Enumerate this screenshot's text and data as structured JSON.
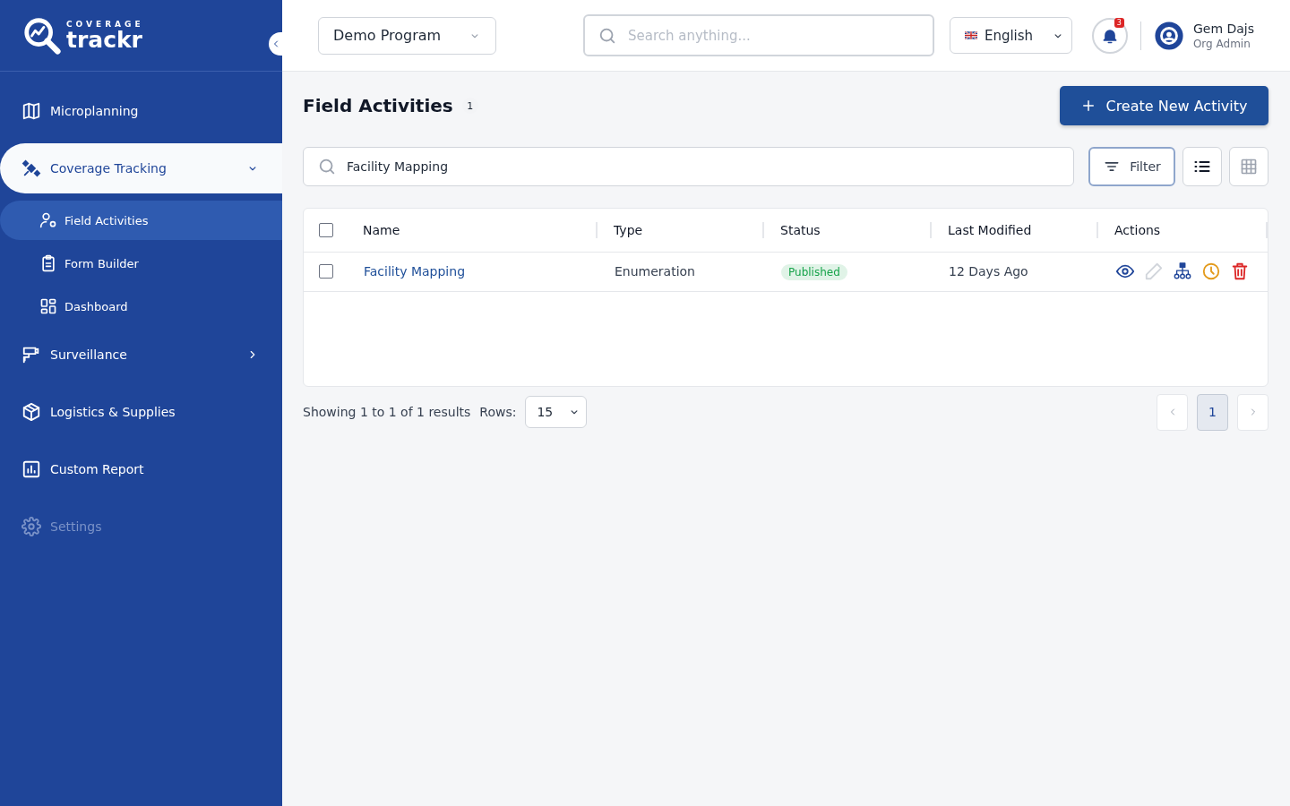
{
  "sidebar": {
    "logo": {
      "small": "COVERAGE",
      "big": "trackr"
    },
    "items": [
      {
        "label": "Microplanning",
        "selected": false,
        "disabled": false
      },
      {
        "label": "Coverage Tracking",
        "selected": true,
        "expanded": true,
        "disabled": false,
        "children": [
          {
            "label": "Field Activities",
            "selected": true
          },
          {
            "label": "Form Builder",
            "selected": false
          },
          {
            "label": "Dashboard",
            "selected": false
          }
        ]
      },
      {
        "label": "Surveillance",
        "selected": false,
        "expanded": false,
        "disabled": false
      },
      {
        "label": "Logistics & Supplies",
        "selected": false,
        "disabled": false
      },
      {
        "label": "Custom Report",
        "selected": false,
        "disabled": false
      },
      {
        "label": "Settings",
        "selected": false,
        "disabled": true
      }
    ]
  },
  "header": {
    "program": "Demo Program",
    "search": {
      "placeholder": "Search anything..."
    },
    "language": "English",
    "notifications": "3",
    "user": {
      "name": "Gem Dajs",
      "role": "Org Admin"
    }
  },
  "page": {
    "title": "Field Activities",
    "count": "1",
    "create_button": "Create New Activity",
    "search": {
      "value": "Facility Mapping"
    },
    "filter_button": "Filter",
    "view_buttons": [
      {
        "kind": "list",
        "selected": true
      },
      {
        "kind": "grid",
        "selected": false
      }
    ],
    "table": {
      "select_all": {
        "checked": false
      },
      "columns": [
        "Name",
        "Type",
        "Status",
        "Last Modified",
        "Actions"
      ],
      "rows": [
        {
          "checked": false,
          "name": "Facility Mapping",
          "type": "Enumeration",
          "status": {
            "label": "Published",
            "color": "#16a34a"
          },
          "modified": "12 Days Ago",
          "actions": [
            {
              "kind": "view",
              "disabled": false
            },
            {
              "kind": "edit",
              "disabled": true
            },
            {
              "kind": "structure",
              "disabled": false
            },
            {
              "kind": "history",
              "disabled": false
            },
            {
              "kind": "delete",
              "disabled": false
            }
          ]
        }
      ]
    },
    "footer": {
      "summary": "Showing 1 to 1 of 1 results",
      "rows_label": "Rows:",
      "rows_value": "15",
      "pages": [
        {
          "label": "1",
          "selected": true
        }
      ]
    }
  }
}
